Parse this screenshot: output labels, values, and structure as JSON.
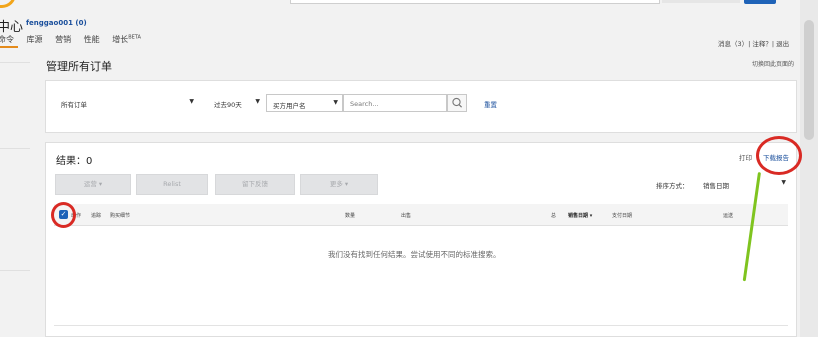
{
  "header": {
    "center_title": "中心",
    "username": "fenggao001 (0)",
    "nav_tabs": [
      {
        "label": "命令"
      },
      {
        "label": "库源"
      },
      {
        "label": "营销"
      },
      {
        "label": "性能"
      },
      {
        "label": "增长",
        "badge": "BETA"
      }
    ],
    "right_links": "消息（3）| 注释？| 退出"
  },
  "page": {
    "title": "管理所有订单",
    "switch_link": "切换回此页面的"
  },
  "filters": {
    "order_type": "所有订单",
    "date_range": "过去90天",
    "search_field": "买方用户名",
    "search_placeholder": "Search...",
    "reset_label": "重置"
  },
  "results": {
    "count_label": "结果：0",
    "print_label": "打印",
    "download_label": "下载报告",
    "buttons": {
      "b1": "运营",
      "b2": "Relist",
      "b3": "留下反馈",
      "b4": "更多"
    },
    "sort_label": "排序方式：",
    "sort_value": "销售日期",
    "columns": {
      "action": "动作",
      "track": "追踪",
      "item": "购买细节",
      "qty": "数量",
      "sold": "出售",
      "amount": "总",
      "sale_date": "销售日期",
      "paid_date": "支付日期",
      "shipped": "运送"
    },
    "empty_message": "我们没有找到任何结果。尝试使用不同的标准搜索。"
  },
  "colors": {
    "annotation_red": "#d92a24",
    "annotation_green": "#7fc41f",
    "link_blue": "#1a4f9c"
  }
}
